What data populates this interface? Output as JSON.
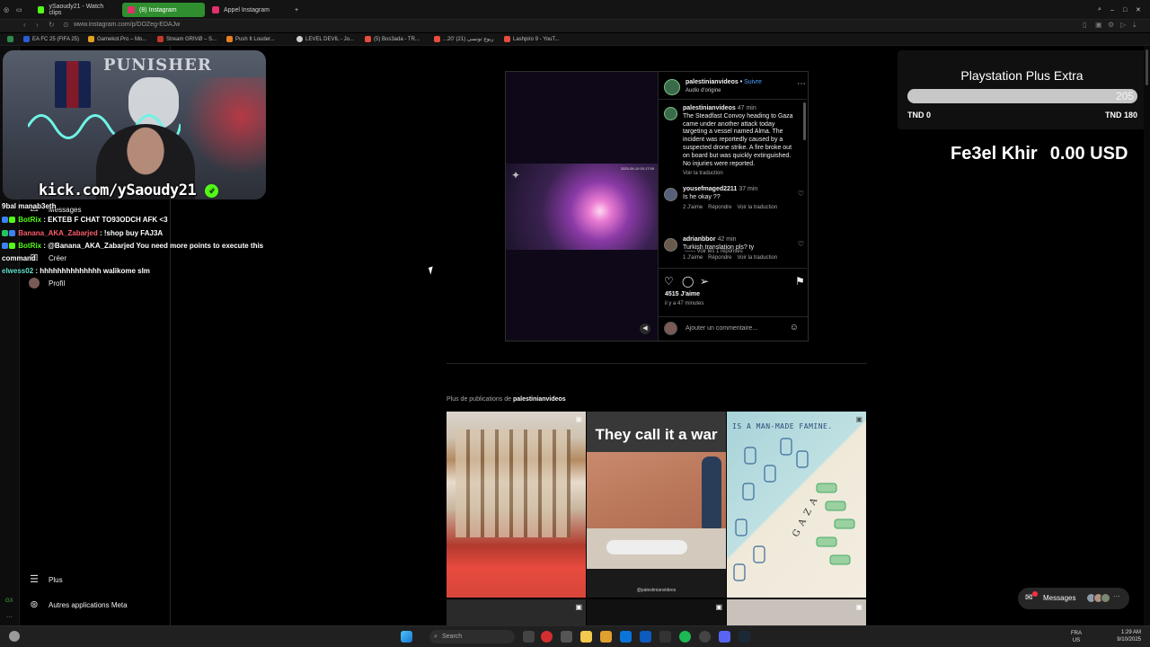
{
  "browser": {
    "tabs": [
      {
        "label": "ySaoudy21 - Watch clips",
        "color": "#53fc18"
      },
      {
        "label": "(8) Instagram",
        "color": "#e1306c"
      },
      {
        "label": "Appel Instagram",
        "color": "#e1306c"
      }
    ],
    "new_tab": "+",
    "url": "www.instagram.com/p/DOZeg-EDAJw",
    "bookmarks": [
      {
        "label": "EA FC 25 (FIFA 25)",
        "color": "#2b5cd6"
      },
      {
        "label": "Gamekot.Pro – Mo...",
        "color": "#e0a020"
      },
      {
        "label": "Stream GRIVØ – S...",
        "color": "#c0392b"
      },
      {
        "label": "Push It Louder...",
        "color": "#e67e22"
      },
      {
        "label": "LEVEL DEVIL - Jo...",
        "color": "#cfcfcf"
      },
      {
        "label": "(5) Bos3ada - TR...",
        "color": "#e74c3c"
      },
      {
        "label": "...20' ربوع تونسي (21)",
        "color": "#e74c3c"
      },
      {
        "label": "Lashpiro 9 - YouT...",
        "color": "#e74c3c"
      }
    ]
  },
  "webcam": {
    "kick_text": "kick.com/ySaoudy21",
    "poster_text": "PUNISHER"
  },
  "chat": [
    {
      "user": "9bal manab3eth",
      "sep": "",
      "msg": "",
      "color": "#ffffff"
    },
    {
      "user": "BotRix",
      "sep": " : ",
      "msg": "EKTEB F CHAT TO93ODCH AFK <3",
      "color": "#53fc18"
    },
    {
      "user": "Banana_AKA_Zabarjed",
      "sep": " : ",
      "msg": "!shop buy FAJ3A",
      "color": "#ff5d6c"
    },
    {
      "user": "BotRix",
      "sep": " : ",
      "msg": "@Banana_AKA_Zabarjed You need more points to execute this",
      "color": "#53fc18"
    },
    {
      "user": "",
      "sep": "",
      "msg": "command",
      "color": "#ffffff"
    },
    {
      "user": "elwess02",
      "sep": " : ",
      "msg": "hhhhhhhhhhhhhh walikome slm",
      "color": "#65e0d0"
    }
  ],
  "sidebar": {
    "messages_label": "Messages",
    "create_label": "Créer",
    "profile_label": "Profil",
    "more_label": "Plus",
    "meta_label": "Autres applications Meta"
  },
  "post": {
    "username": "palestinianvideos",
    "follow": "Suivre",
    "audio": "Audio d'origine",
    "media_timestamp": "2025-09-10 00:17:59",
    "caption": {
      "user": "palestinianvideos",
      "time": "47 min",
      "text": "The Steadfast Convoy heading to Gaza came under another attack today targeting a vessel named Alma. The incident was reportedly caused by a suspected drone strike. A fire broke out on board but was quickly extinguished. No injuries were reported.",
      "translate": "Voir la traduction"
    },
    "comments": [
      {
        "user": "yousefmaged2211",
        "time": "37 min",
        "text": "Is he okay ??",
        "likes": "2 J'aime",
        "reply": "Répondre",
        "translate": "Voir la traduction"
      },
      {
        "user": "adrianbbor",
        "time": "42 min",
        "text": "Turkish translation pls? ty",
        "likes": "1 J'aime",
        "reply": "Répondre",
        "translate": "Voir la traduction"
      }
    ],
    "view_replies": "Voir les 1 réponses",
    "likes": "4515 J'aime",
    "ago": "il y a 47 minutes",
    "add_comment_placeholder": "Ajouter un commentaire..."
  },
  "more_posts": {
    "prefix": "Plus de publications de",
    "user": "palestinianvideos",
    "thumbs": [
      {
        "overlay": ""
      },
      {
        "overlay": "They call it a war",
        "caption": "@palestinianvideos"
      },
      {
        "overlay": "IS A MAN-MADE FAMINE.",
        "map_label": "GAZA"
      }
    ]
  },
  "goal": {
    "title": "Playstation Plus Extra",
    "current": 205,
    "low_label": "TND 0",
    "high_label": "TND 180",
    "fill_fraction": 1.0
  },
  "donor": {
    "name": "Fe3el Khir",
    "amount": "0.00 USD"
  },
  "messages_pill": {
    "label": "Messages",
    "badge": "9"
  },
  "taskbar": {
    "search_placeholder": "Search",
    "lang_top": "FRA",
    "lang_bottom": "US",
    "time": "1:29 AM",
    "date": "9/10/2025"
  }
}
